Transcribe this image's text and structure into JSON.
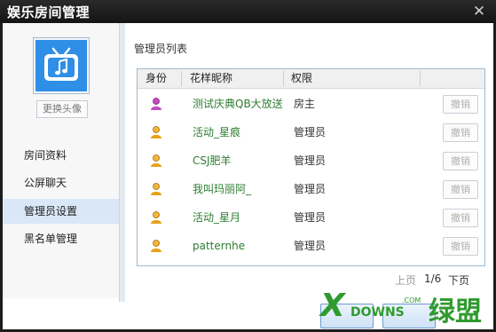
{
  "window": {
    "title": "娱乐房间管理",
    "close_glyph": "✕"
  },
  "sidebar": {
    "avatar_icon": "music-tv-icon",
    "change_avatar_label": "更换头像",
    "items": [
      {
        "label": "房间资料"
      },
      {
        "label": "公屏聊天"
      },
      {
        "label": "管理员设置",
        "active": true
      },
      {
        "label": "黑名单管理"
      }
    ]
  },
  "main": {
    "panel_title": "管理员列表",
    "table": {
      "headers": [
        "身份",
        "花样昵称",
        "权限"
      ],
      "rows": [
        {
          "role_icon": "owner-person-icon",
          "nickname": "测试庆典QB大放送",
          "permission": "房主",
          "action": "撤销"
        },
        {
          "role_icon": "admin-person-icon",
          "nickname": "活动_星痕",
          "permission": "管理员",
          "action": "撤销"
        },
        {
          "role_icon": "admin-person-icon",
          "nickname": "CSJ肥羊",
          "permission": "管理员",
          "action": "撤销"
        },
        {
          "role_icon": "admin-person-icon",
          "nickname": "我叫玛丽阿_",
          "permission": "管理员",
          "action": "撤销"
        },
        {
          "role_icon": "admin-person-icon",
          "nickname": "活动_星月",
          "permission": "管理员",
          "action": "撤销"
        },
        {
          "role_icon": "admin-person-icon",
          "nickname": "patternhe",
          "permission": "管理员",
          "action": "撤销"
        }
      ]
    },
    "pager": {
      "prev": "上页",
      "page": "1/6",
      "next": "下页"
    }
  },
  "watermark": {
    "logo_text": "X DOWNS 绿盟 .COM"
  },
  "colors": {
    "titlebar": "#1c1c1c",
    "nickname": "#2e7d32",
    "owner_icon": "#c04bc0",
    "admin_icon": "#e8a11a",
    "active_nav": "#d9e7f6",
    "table_border": "#9fb8cf"
  }
}
